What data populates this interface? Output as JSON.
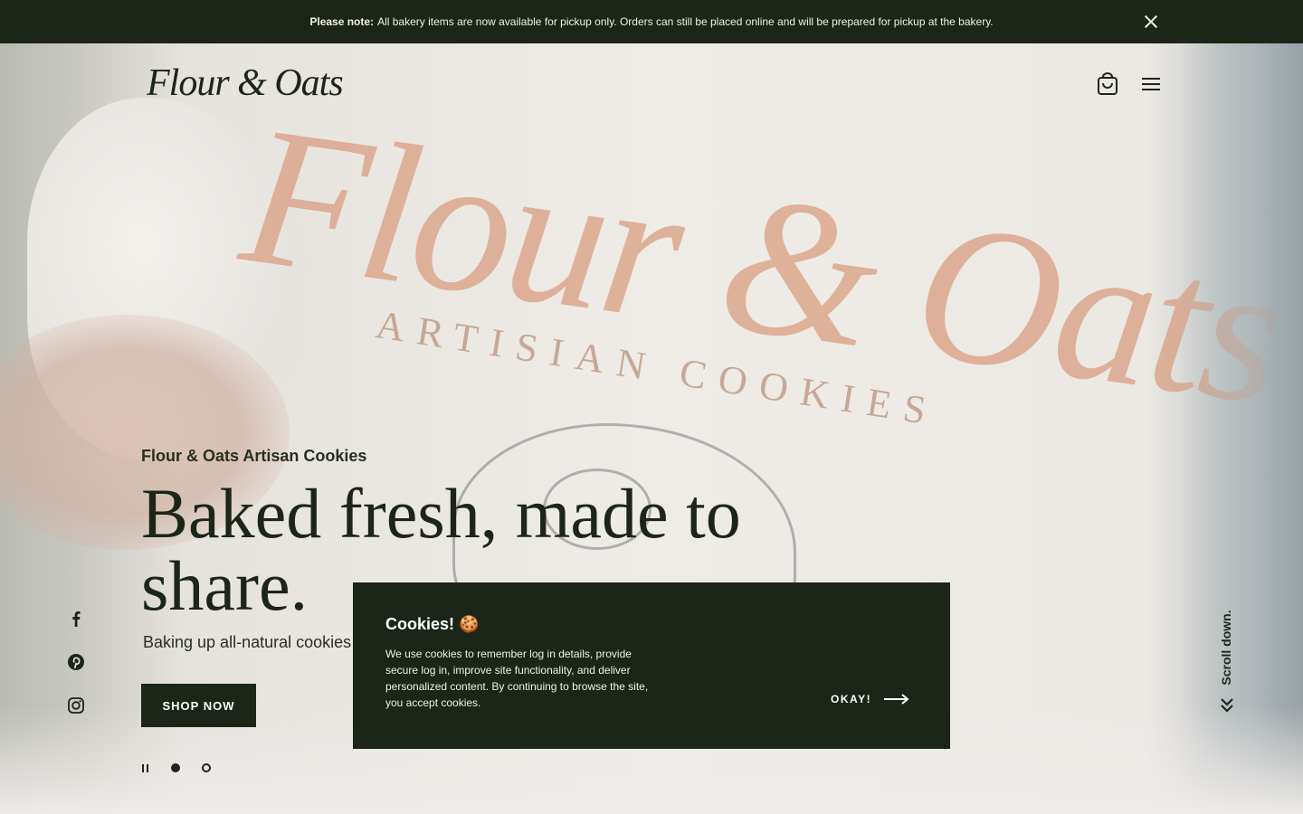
{
  "announcement": {
    "lead": "Please note:",
    "text": "All bakery items are now available for pickup only. Orders can still be placed online and will be prepared for pickup at the bakery."
  },
  "header": {
    "logo_text": "Flour & Oats"
  },
  "hero": {
    "eyebrow": "Flour & Oats Artisan Cookies",
    "headline": "Baked fresh, made to share.",
    "subtext": "Baking up all-natural cookies",
    "cta_label": "SHOP NOW"
  },
  "scroll": {
    "label": "Scroll down."
  },
  "cookie_banner": {
    "title": "Cookies! 🍪",
    "body": "We use cookies to remember log in details, provide secure log in, improve site functionality, and deliver personalized content. By continuing to browse the site, you accept cookies.",
    "accept_label": "OKAY!"
  },
  "colors": {
    "primary_dark": "#1c2618",
    "light_text": "#f2efe9"
  },
  "icons": {
    "social": [
      "facebook-icon",
      "pinterest-icon",
      "instagram-icon"
    ],
    "header": [
      "cart-icon",
      "menu-icon"
    ]
  }
}
